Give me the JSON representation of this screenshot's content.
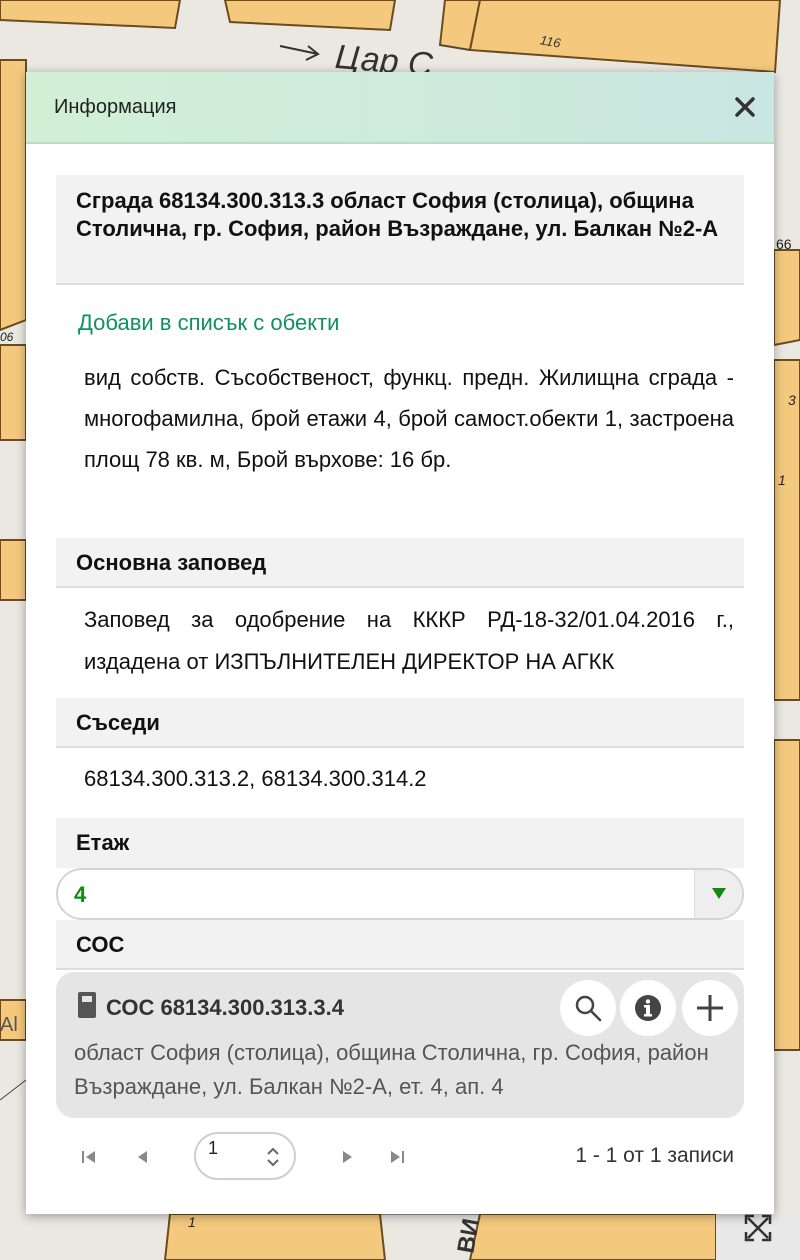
{
  "map": {
    "parcel_label_top": "116",
    "street_label": "Цар С",
    "side_label_right": "66",
    "side_label_left": "06",
    "side_label_right_2": "3",
    "side_label_right_3": "1",
    "street_label_bottom": "ВИ",
    "bottom_number": "1",
    "side_label_left_2": "Al",
    "icons": [
      "expand-icon"
    ]
  },
  "dialog": {
    "title": "Информация",
    "close_icon": "close-icon",
    "building": {
      "heading": "Сграда 68134.300.313.3 област София (столица), община Столична, гр. София, район Възраждане, ул. Балкан №2-А",
      "add_to_list": "Добави в списък с обекти",
      "description": "вид собств. Съсобственост, функц. предн. Жилищна сграда - многофамилна, брой етажи 4, брой самост.обекти 1, застроена площ 78 кв. м, Брой върхове: 16 бр."
    },
    "main_order": {
      "heading": "Основна заповед",
      "text": "Заповед за одобрение на КККР РД-18-32/01.04.2016 г., издадена от ИЗПЪЛНИТЕЛЕН ДИРЕКТОР НА АГКК"
    },
    "neighbours": {
      "heading": "Съседи",
      "text": "68134.300.313.2, 68134.300.314.2"
    },
    "floor": {
      "heading": "Етаж",
      "selected": "4"
    },
    "sos": {
      "heading": "СОС",
      "item": {
        "title": "СОС 68134.300.313.3.4",
        "address": "област София (столица), община Столична, гр. София, район Възраждане, ул. Балкан №2-А, ет. 4, ап. 4",
        "icons": [
          "building-icon",
          "search-icon",
          "info-icon",
          "plus-icon"
        ]
      }
    },
    "pager": {
      "page": "1",
      "info": "1 - 1 от 1 записи",
      "icons": [
        "first-page-icon",
        "prev-page-icon",
        "next-page-icon",
        "last-page-icon"
      ]
    }
  },
  "colors": {
    "parcel_fill": "#f4c97e",
    "parcel_stroke": "#6b4b1f",
    "link_green": "#119161",
    "floor_value_green": "#118a11",
    "header_green": "#d2efd6"
  }
}
